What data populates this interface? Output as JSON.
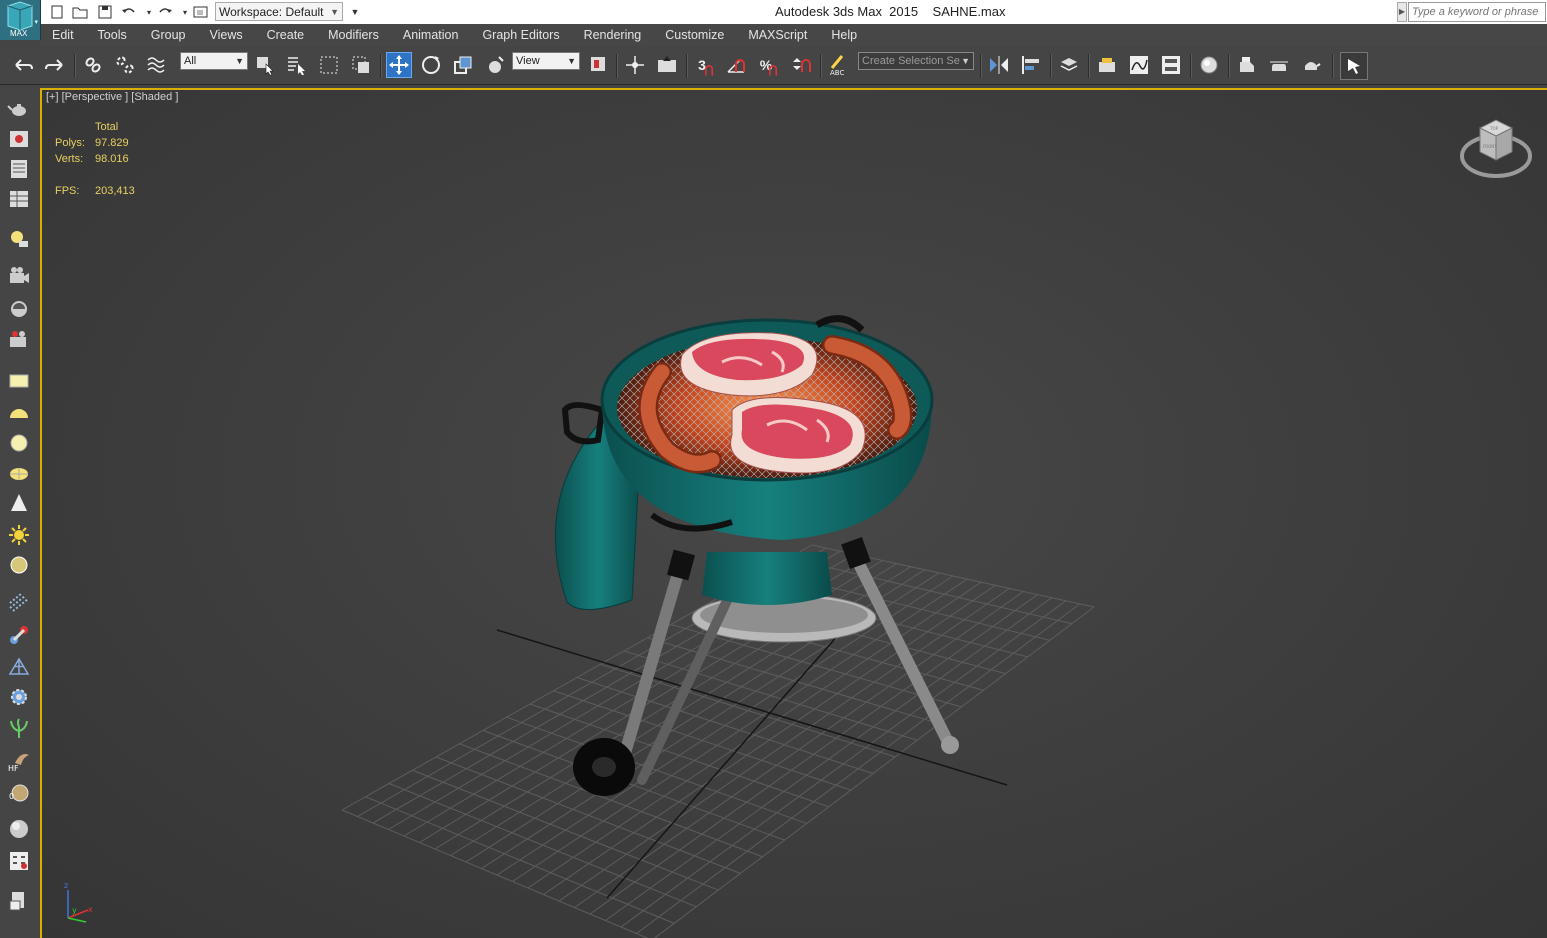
{
  "app": {
    "title": "Autodesk 3ds Max  2015    SAHNE.max",
    "logo_label": "MAX"
  },
  "quick_access": {
    "workspace": "Workspace: Default",
    "search_placeholder": "Type a keyword or phrase"
  },
  "menu": [
    "Edit",
    "Tools",
    "Group",
    "Views",
    "Create",
    "Modifiers",
    "Animation",
    "Graph Editors",
    "Rendering",
    "Customize",
    "MAXScript",
    "Help"
  ],
  "toolbar": {
    "selection_filter": "All",
    "reference_coord": "View",
    "named_selection_placeholder": "Create Selection Se",
    "snap_label": "3"
  },
  "viewport": {
    "label": "[+] [Perspective ] [Shaded ]",
    "stats": {
      "total_label": "Total",
      "polys_label": "Polys:",
      "polys_value": "97.829",
      "verts_label": "Verts:",
      "verts_value": "98.016",
      "fps_label": "FPS:",
      "fps_value": "203,413"
    },
    "viewcube": {
      "top": "TOP",
      "front": "FRONT"
    }
  },
  "left_panel": {
    "label_hf": "HF"
  },
  "colors": {
    "accent_active": "#2f74c4",
    "viewport_border": "#d9b000",
    "stats_text": "#e8d060",
    "grill_teal": "#0f6b6a",
    "meat": "#d9485c",
    "sausage": "#c85a35"
  }
}
